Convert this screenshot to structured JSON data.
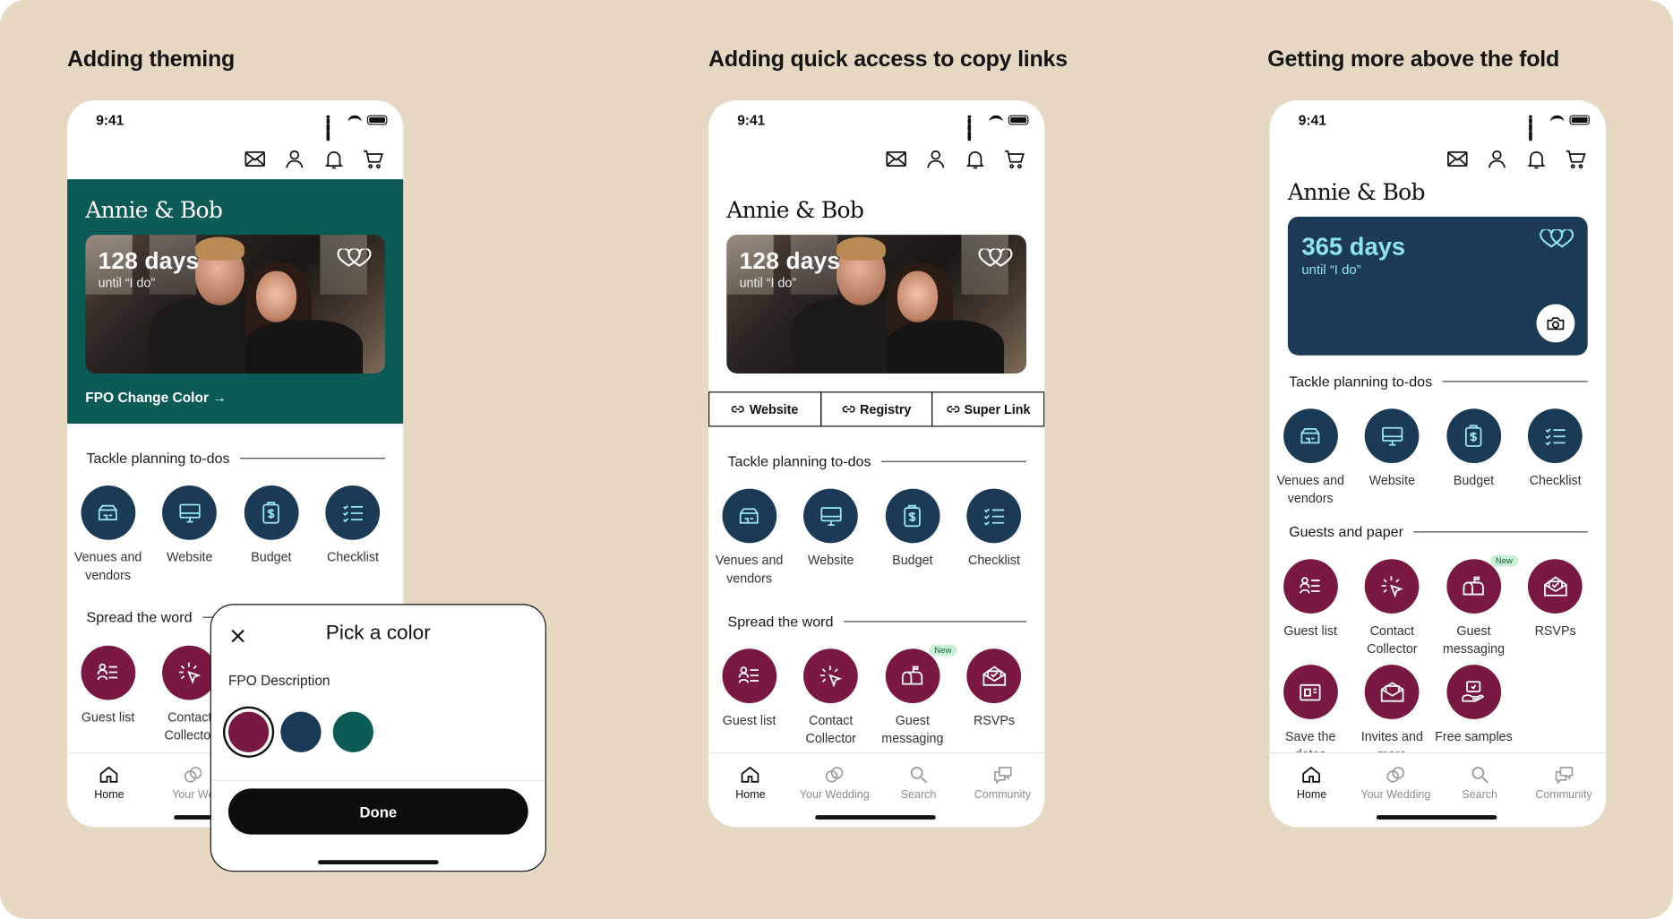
{
  "columns": [
    {
      "title": "Adding theming"
    },
    {
      "title": "Adding quick access to copy links"
    },
    {
      "title": "Getting more above the fold"
    }
  ],
  "status_time": "9:41",
  "couple_name": "Annie & Bob",
  "countdown_a": {
    "days": "128 days",
    "until": "until “I do”"
  },
  "countdown_c": {
    "days": "365 days",
    "until": "until “I do”"
  },
  "theme_link": "FPO Change Color →",
  "sections": {
    "planning": "Tackle planning to-dos",
    "spread": "Spread the word",
    "guests": "Guests and paper"
  },
  "planning_items": [
    {
      "label": "Venues and vendors",
      "icon": "venue-icon"
    },
    {
      "label": "Website",
      "icon": "monitor-icon"
    },
    {
      "label": "Budget",
      "icon": "budget-icon"
    },
    {
      "label": "Checklist",
      "icon": "checklist-icon"
    }
  ],
  "spread_items": [
    {
      "label": "Guest list",
      "icon": "guest-list-icon"
    },
    {
      "label": "Contact Collector",
      "icon": "cursor-click-icon"
    },
    {
      "label": "Guest messaging",
      "icon": "mailbox-icon",
      "badge": "New"
    },
    {
      "label": "RSVPs",
      "icon": "rsvp-envelope-icon"
    }
  ],
  "paper_items": [
    {
      "label": "Save the dates",
      "icon": "save-date-icon"
    },
    {
      "label": "Invites and more",
      "icon": "invite-icon"
    },
    {
      "label": "Free samples",
      "icon": "samples-icon"
    }
  ],
  "links": [
    {
      "label": "Website"
    },
    {
      "label": "Registry"
    },
    {
      "label": "Super Link"
    }
  ],
  "tabs": [
    {
      "label": "Home",
      "icon": "home-icon"
    },
    {
      "label": "Your Wedding",
      "icon": "rings-icon"
    },
    {
      "label": "Search",
      "icon": "search-icon"
    },
    {
      "label": "Community",
      "icon": "chat-icon"
    }
  ],
  "tabs_a_partial": {
    "home": "Home",
    "wedding": "Your We"
  },
  "sheet": {
    "title": "Pick a color",
    "description": "FPO Description",
    "swatches": [
      "#7a1844",
      "#1b3a55",
      "#0b5a55"
    ],
    "selected": 0,
    "done_label": "Done"
  },
  "colors": {
    "teal_theme": "#0b5a55",
    "navy": "#1b3a55",
    "plum": "#7a1844",
    "background": "#e7d8c4"
  }
}
